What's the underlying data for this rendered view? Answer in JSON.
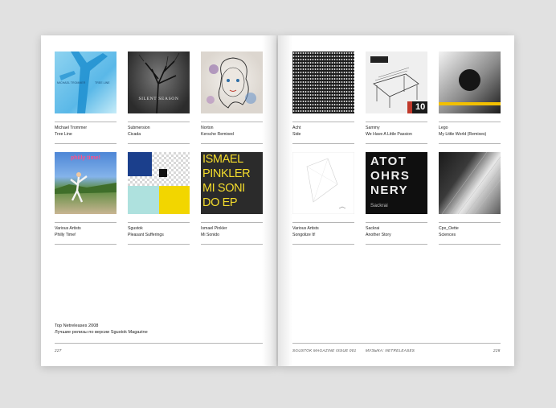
{
  "left_page": {
    "items": [
      {
        "artist": "Michael Trommer",
        "title": "Tree Line",
        "cover": {
          "lines": [
            "MICHAEL TROMMER",
            "TREE LINE"
          ]
        }
      },
      {
        "artist": "Submersion",
        "title": "Cicada",
        "cover": {
          "lines": [
            "SILENT SEASON"
          ]
        }
      },
      {
        "artist": "Norton",
        "title": "Kersche Remixed",
        "cover": {
          "lines": []
        }
      },
      {
        "artist": "Various Artists",
        "title": "Philly Time!",
        "cover": {
          "lines": [
            "philly time!"
          ]
        }
      },
      {
        "artist": "Sgustok",
        "title": "Pleasant Sufferings",
        "cover": {
          "lines": []
        }
      },
      {
        "artist": "Ismael Pinkler",
        "title": "Mi Sonido",
        "cover": {
          "lines": [
            "ISMAEL",
            "PINKLER",
            "MI SONI",
            "DO EP"
          ]
        }
      }
    ],
    "note_line1": "Top Netreleases 2008",
    "note_line2": "Лучшие релизы по версии Sgustok Magazine",
    "page_number": "227"
  },
  "right_page": {
    "items": [
      {
        "artist": "Acht",
        "title": "Side",
        "cover": {
          "lines": []
        }
      },
      {
        "artist": "Sammy",
        "title": "We Have A Little Passion",
        "cover": {
          "lines": [
            "10"
          ]
        }
      },
      {
        "artist": "Lego",
        "title": "My Little World (Remixes)",
        "cover": {
          "lines": []
        }
      },
      {
        "artist": "Various Artists",
        "title": "Songolize It!",
        "cover": {
          "lines": []
        }
      },
      {
        "artist": "Sackrai",
        "title": "Another Story",
        "cover": {
          "lines": [
            "ATOT",
            "OHRS",
            "NERY",
            "Sackrai"
          ]
        }
      },
      {
        "artist": "Cpx_Oette",
        "title": "Sciences",
        "cover": {
          "lines": []
        }
      }
    ],
    "folio_left": "SGUSTOK MAGAZINE ISSUE 001",
    "folio_center": "МУЗЫКА: NETRELEASES",
    "page_number": "228"
  },
  "colors": {
    "background": "#e1e1e1",
    "paper": "#ffffff",
    "rule": "#b5b5b5"
  }
}
